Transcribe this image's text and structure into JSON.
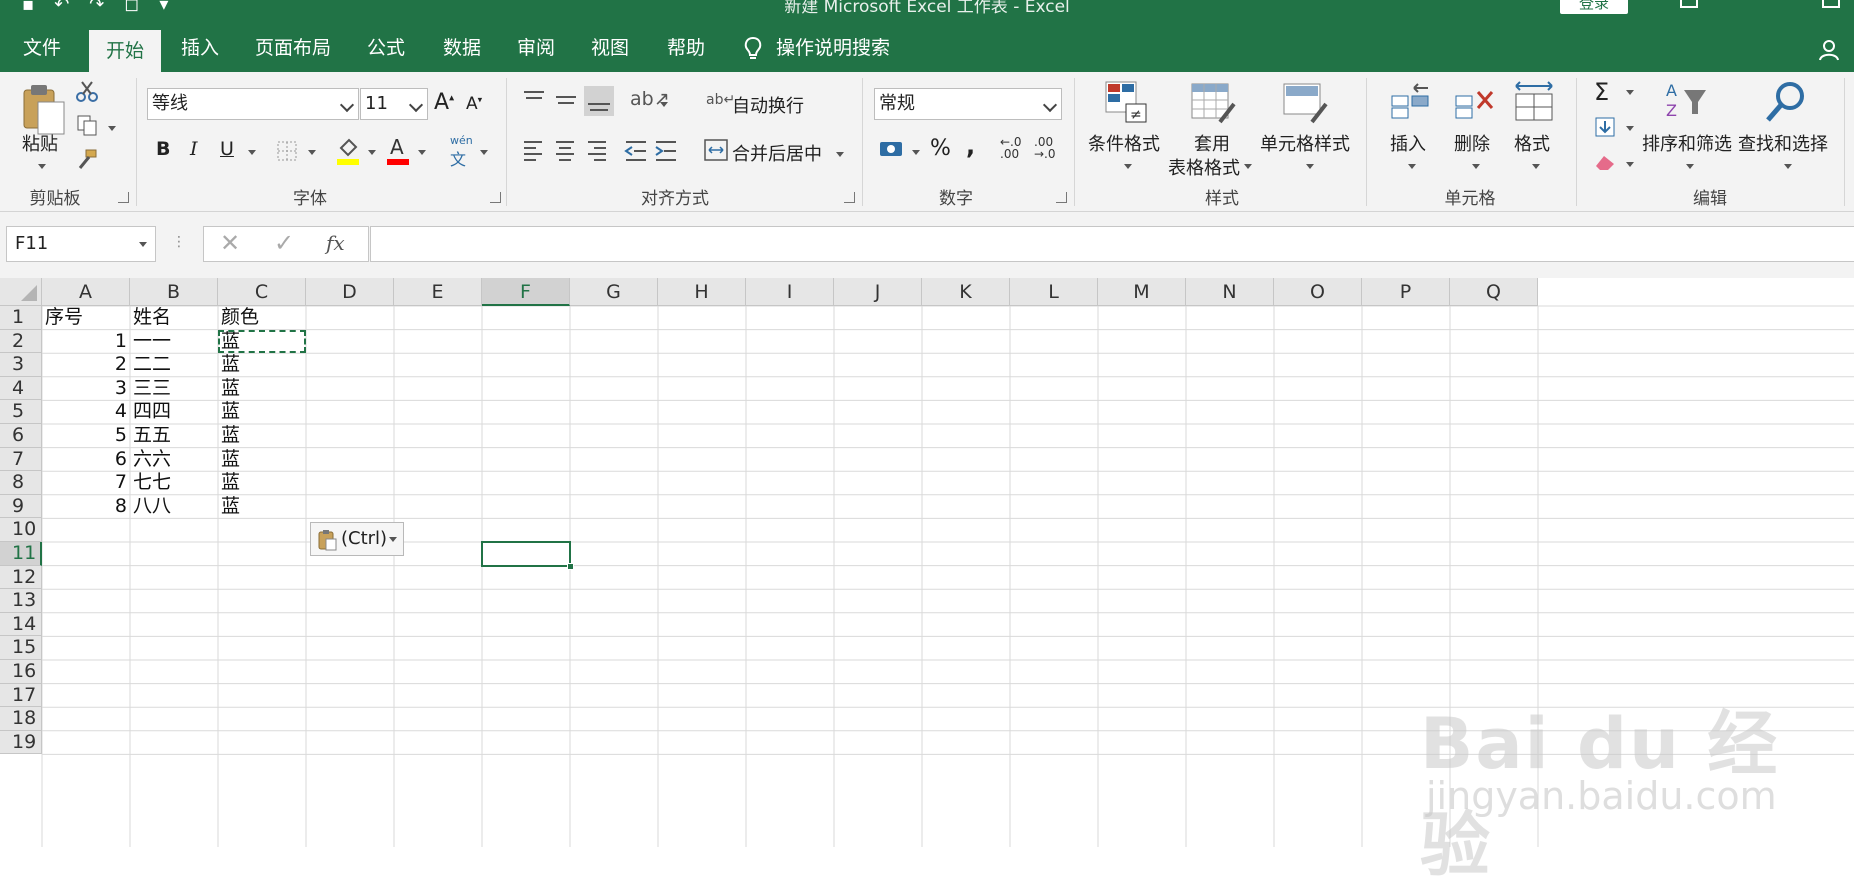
{
  "window": {
    "title": "新建 Microsoft Excel 工作表 - Excel",
    "login_label": "登录"
  },
  "ribbon_tabs": [
    "文件",
    "开始",
    "插入",
    "页面布局",
    "公式",
    "数据",
    "审阅",
    "视图",
    "帮助"
  ],
  "active_tab": "开始",
  "tell_me": "操作说明搜索",
  "clipboard": {
    "paste": "粘贴",
    "label": "剪贴板"
  },
  "font": {
    "name": "等线",
    "size": "11",
    "bold": "B",
    "italic": "I",
    "underline": "U",
    "phonetic_top": "wén",
    "phonetic_bottom": "文",
    "label": "字体",
    "highlight_color": "#ffff00",
    "font_color": "#ff0000"
  },
  "alignment": {
    "wrap": "自动换行",
    "merge": "合并后居中",
    "label": "对齐方式"
  },
  "number": {
    "format": "常规",
    "percent": "%",
    "comma": ",",
    "label": "数字"
  },
  "styles": {
    "conditional": "条件格式",
    "table_line1": "套用",
    "table_line2": "表格格式",
    "cell_styles": "单元格样式",
    "label": "样式"
  },
  "cells": {
    "insert": "插入",
    "delete": "删除",
    "format": "格式",
    "label": "单元格"
  },
  "editing": {
    "sort_filter": "排序和筛选",
    "find_select": "查找和选择",
    "label": "编辑"
  },
  "formula_bar": {
    "name_box": "F11",
    "fx": "fx",
    "formula": ""
  },
  "columns": [
    "A",
    "B",
    "C",
    "D",
    "E",
    "F",
    "G",
    "H",
    "I",
    "J",
    "K",
    "L",
    "M",
    "N",
    "O",
    "P",
    "Q"
  ],
  "rows": [
    "1",
    "2",
    "3",
    "4",
    "5",
    "6",
    "7",
    "8",
    "9",
    "10",
    "11",
    "12",
    "13",
    "14",
    "15",
    "16",
    "17",
    "18",
    "19"
  ],
  "selected_column": "F",
  "selected_row": "11",
  "sheet": {
    "header": [
      "序号",
      "姓名",
      "颜色"
    ],
    "data": [
      [
        "1",
        "一一",
        "蓝"
      ],
      [
        "2",
        "二二",
        "蓝"
      ],
      [
        "3",
        "三三",
        "蓝"
      ],
      [
        "4",
        "四四",
        "蓝"
      ],
      [
        "5",
        "五五",
        "蓝"
      ],
      [
        "6",
        "六六",
        "蓝"
      ],
      [
        "7",
        "七七",
        "蓝"
      ],
      [
        "8",
        "八八",
        "蓝"
      ]
    ]
  },
  "paste_options": "(Ctrl)",
  "watermark": {
    "main": "Bai du 经验",
    "sub": "jingyan.baidu.com"
  },
  "colors": {
    "excel_green": "#217346",
    "ribbon_bg": "#f3f3f3"
  }
}
